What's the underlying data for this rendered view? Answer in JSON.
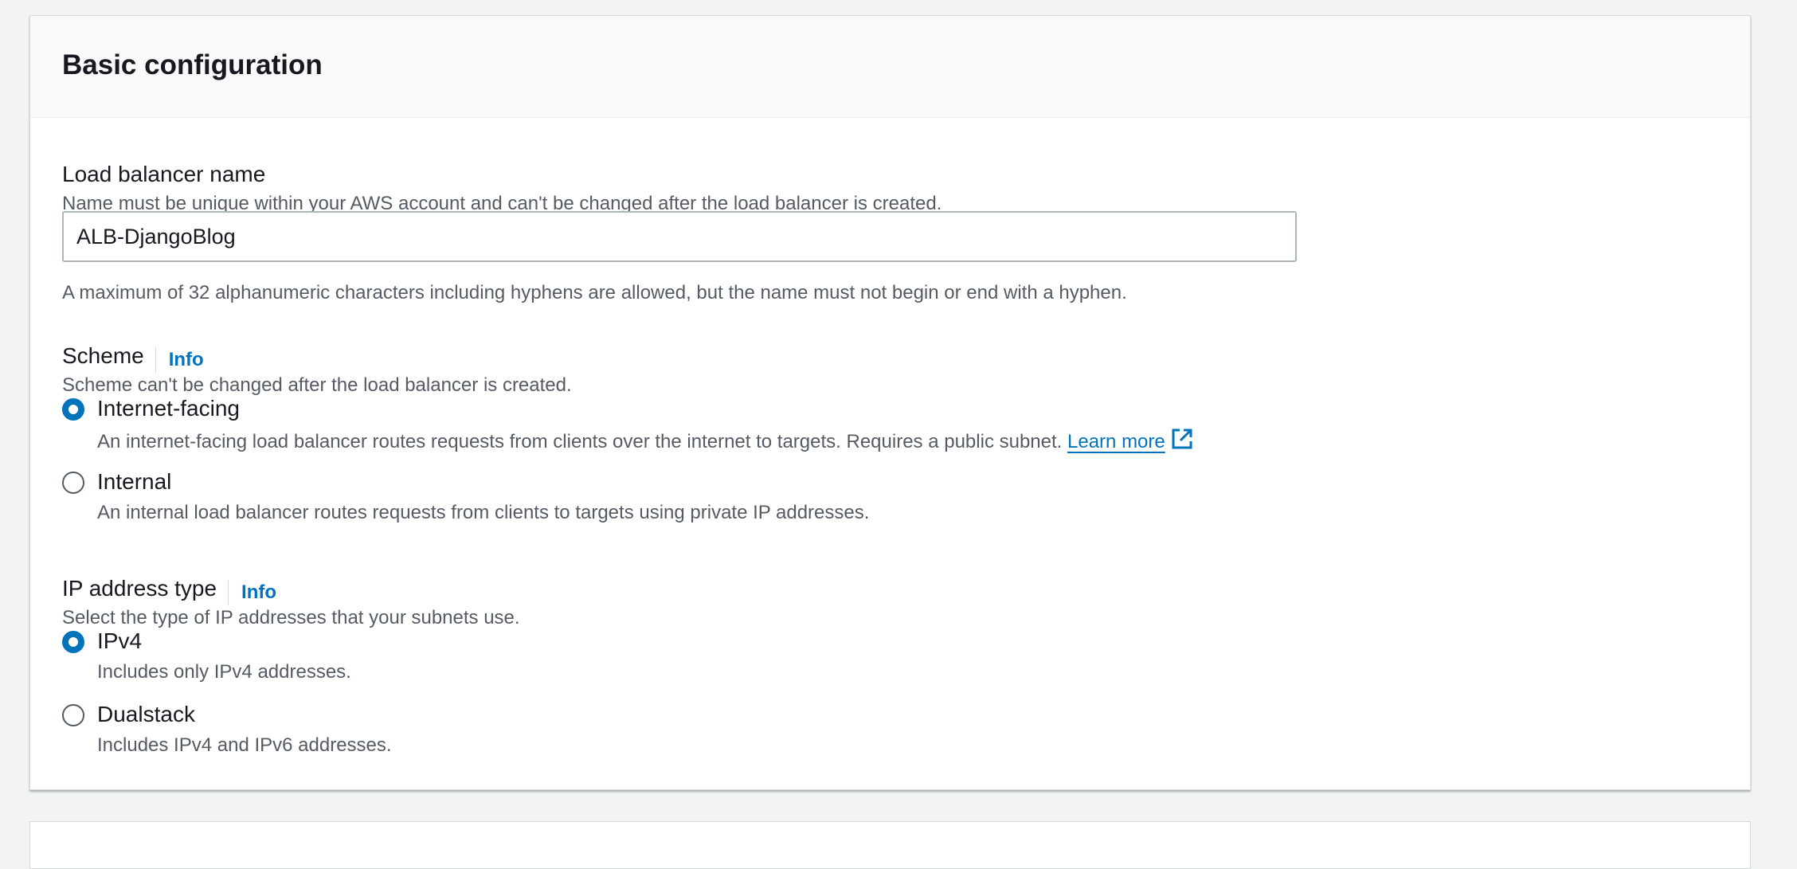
{
  "section": {
    "title": "Basic configuration"
  },
  "lb_name": {
    "label": "Load balancer name",
    "description": "Name must be unique within your AWS account and can't be changed after the load balancer is created.",
    "value": "ALB-DjangoBlog",
    "constraint": "A maximum of 32 alphanumeric characters including hyphens are allowed, but the name must not begin or end with a hyphen."
  },
  "scheme": {
    "label": "Scheme",
    "info": "Info",
    "description": "Scheme can't be changed after the load balancer is created.",
    "options": [
      {
        "label": "Internet-facing",
        "description": "An internet-facing load balancer routes requests from clients over the internet to targets. Requires a public subnet.",
        "link": "Learn more",
        "selected": true
      },
      {
        "label": "Internal",
        "description": "An internal load balancer routes requests from clients to targets using private IP addresses.",
        "selected": false
      }
    ]
  },
  "ip_type": {
    "label": "IP address type",
    "info": "Info",
    "description": "Select the type of IP addresses that your subnets use.",
    "options": [
      {
        "label": "IPv4",
        "description": "Includes only IPv4 addresses.",
        "selected": true
      },
      {
        "label": "Dualstack",
        "description": "Includes IPv4 and IPv6 addresses.",
        "selected": false
      }
    ]
  },
  "colors": {
    "accent": "#0073bb",
    "text": "#16191f",
    "secondary_text": "#545b64",
    "background": "#f2f3f3"
  },
  "icons": {
    "external_link": "external-link-icon"
  }
}
